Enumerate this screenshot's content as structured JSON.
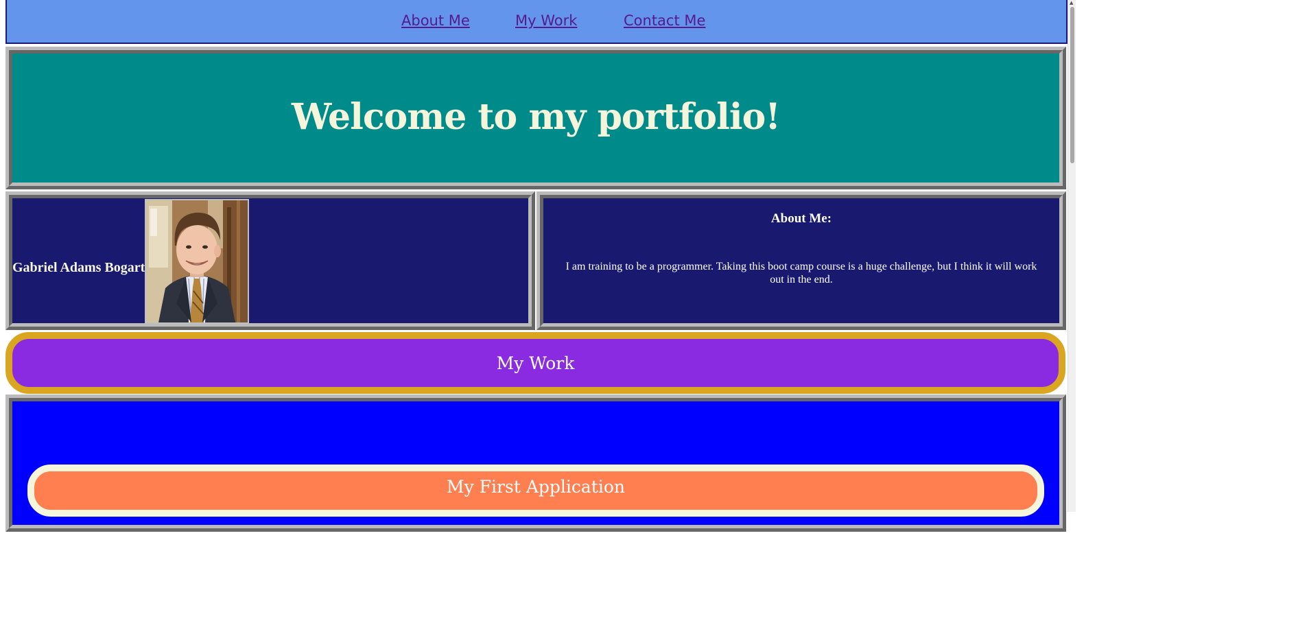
{
  "nav": {
    "links": [
      {
        "label": "About Me"
      },
      {
        "label": "My Work"
      },
      {
        "label": "Contact Me"
      }
    ]
  },
  "header": {
    "title": "Welcome to my portfolio!"
  },
  "profile": {
    "name": "Gabriel Adams Bogart",
    "photo_icon": "person-photo-icon"
  },
  "about": {
    "heading": "About Me:",
    "body": "I am training to be a programmer. Taking this boot camp course is a huge challenge, but I think it will work out in the end."
  },
  "work_section": {
    "heading": "My Work"
  },
  "projects": [
    {
      "title": "My First Application"
    }
  ],
  "scrollbar": {
    "up_arrow_icon": "▲"
  },
  "colors": {
    "nav_bg": "#6495ed",
    "header_bg": "#008b8b",
    "panel_bg": "#191970",
    "work_banner_bg": "#8a2be2",
    "work_banner_border": "#daa520",
    "projects_bg": "#0000ff",
    "project_card_bg": "#ff7f50",
    "accent_text": "#f5f5dc"
  }
}
